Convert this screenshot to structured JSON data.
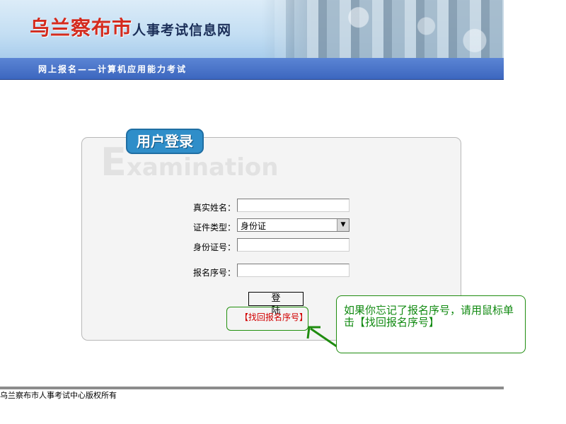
{
  "header": {
    "title_city": "乌兰察布市",
    "title_rest": "人事考试信息网",
    "subnav": "网上报名——计算机应用能力考试"
  },
  "login": {
    "tab_label": "用户登录",
    "watermark_first": "E",
    "watermark_rest": "xamination",
    "fields": {
      "name_label": "真实姓名：",
      "name_value": "",
      "id_type_label": "证件类型：",
      "id_type_selected": "身份证",
      "id_number_label": "身份证号：",
      "id_number_value": "",
      "reg_no_label": "报名序号：",
      "reg_no_value": ""
    },
    "submit_label": "登陆",
    "recover_link": "【找回报名序号】"
  },
  "callout": {
    "text": "如果你忘记了报名序号，请用鼠标单击【找回报名序号】"
  },
  "footer": {
    "copyright": "乌兰察布市人事考试中心版权所有"
  },
  "colors": {
    "title_red": "#d42b1e",
    "subnav_blue": "#3c67bf",
    "callout_green": "#118a11",
    "link_red": "#d10000"
  }
}
